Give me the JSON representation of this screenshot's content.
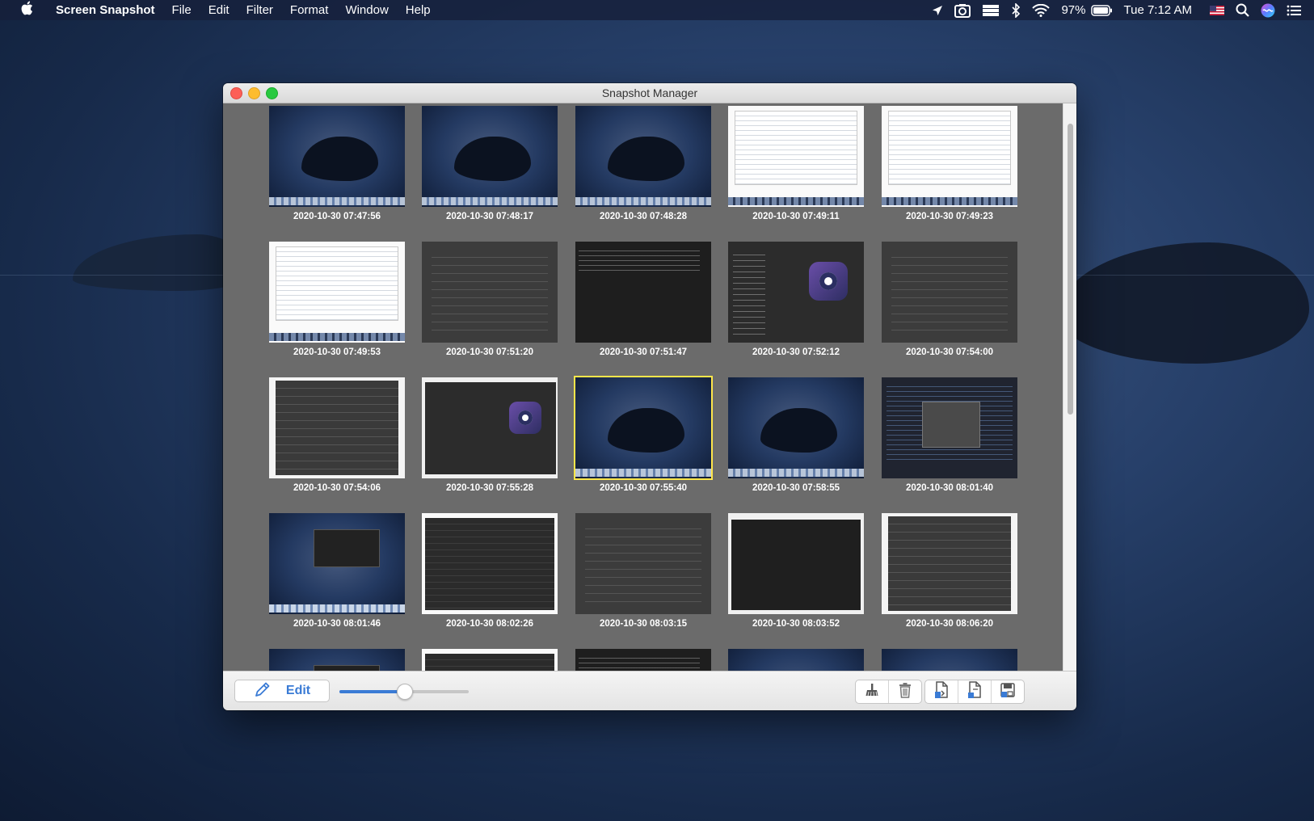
{
  "menubar": {
    "app_name": "Screen Snapshot",
    "menus": [
      "File",
      "Edit",
      "Filter",
      "Format",
      "Window",
      "Help"
    ],
    "status": {
      "battery": "97%",
      "clock": "Tue 7:12 AM"
    }
  },
  "window": {
    "title": "Snapshot Manager"
  },
  "snapshots": [
    {
      "caption": "2020-10-30 07:47:56",
      "kind": "desktop"
    },
    {
      "caption": "2020-10-30 07:48:17",
      "kind": "desktop"
    },
    {
      "caption": "2020-10-30 07:48:28",
      "kind": "desktop"
    },
    {
      "caption": "2020-10-30 07:49:11",
      "kind": "editor"
    },
    {
      "caption": "2020-10-30 07:49:23",
      "kind": "editor"
    },
    {
      "caption": "2020-10-30 07:49:53",
      "kind": "editor"
    },
    {
      "caption": "2020-10-30 07:51:20",
      "kind": "prefs"
    },
    {
      "caption": "2020-10-30 07:51:47",
      "kind": "terminal"
    },
    {
      "caption": "2020-10-30 07:52:12",
      "kind": "app"
    },
    {
      "caption": "2020-10-30 07:54:00",
      "kind": "prefs"
    },
    {
      "caption": "2020-10-30 07:54:06",
      "kind": "prefs-w"
    },
    {
      "caption": "2020-10-30 07:55:28",
      "kind": "app-w"
    },
    {
      "caption": "2020-10-30 07:55:40",
      "kind": "desktop",
      "selected": true
    },
    {
      "caption": "2020-10-30 07:58:55",
      "kind": "desktop"
    },
    {
      "caption": "2020-10-30 08:01:40",
      "kind": "code"
    },
    {
      "caption": "2020-10-30 08:01:46",
      "kind": "desk-term"
    },
    {
      "caption": "2020-10-30 08:02:26",
      "kind": "finder"
    },
    {
      "caption": "2020-10-30 08:03:15",
      "kind": "prefs"
    },
    {
      "caption": "2020-10-30 08:03:52",
      "kind": "terminal-w"
    },
    {
      "caption": "2020-10-30 08:06:20",
      "kind": "prefs-w"
    },
    {
      "caption": "",
      "kind": "desk-term"
    },
    {
      "caption": "",
      "kind": "finder"
    },
    {
      "caption": "",
      "kind": "terminal"
    },
    {
      "caption": "",
      "kind": "desktop"
    },
    {
      "caption": "",
      "kind": "desktop"
    }
  ],
  "toolbar": {
    "edit_label": "Edit",
    "zoom_slider_value": 0.5,
    "buttons_left_group": [
      "broom-icon",
      "trash-icon"
    ],
    "buttons_right_group": [
      "export-document-icon",
      "save-document-icon",
      "save-disk-icon"
    ]
  },
  "colors": {
    "accent": "#3a7bd5",
    "selection": "#ffe64a",
    "window_bg": "#6b6b6b"
  }
}
